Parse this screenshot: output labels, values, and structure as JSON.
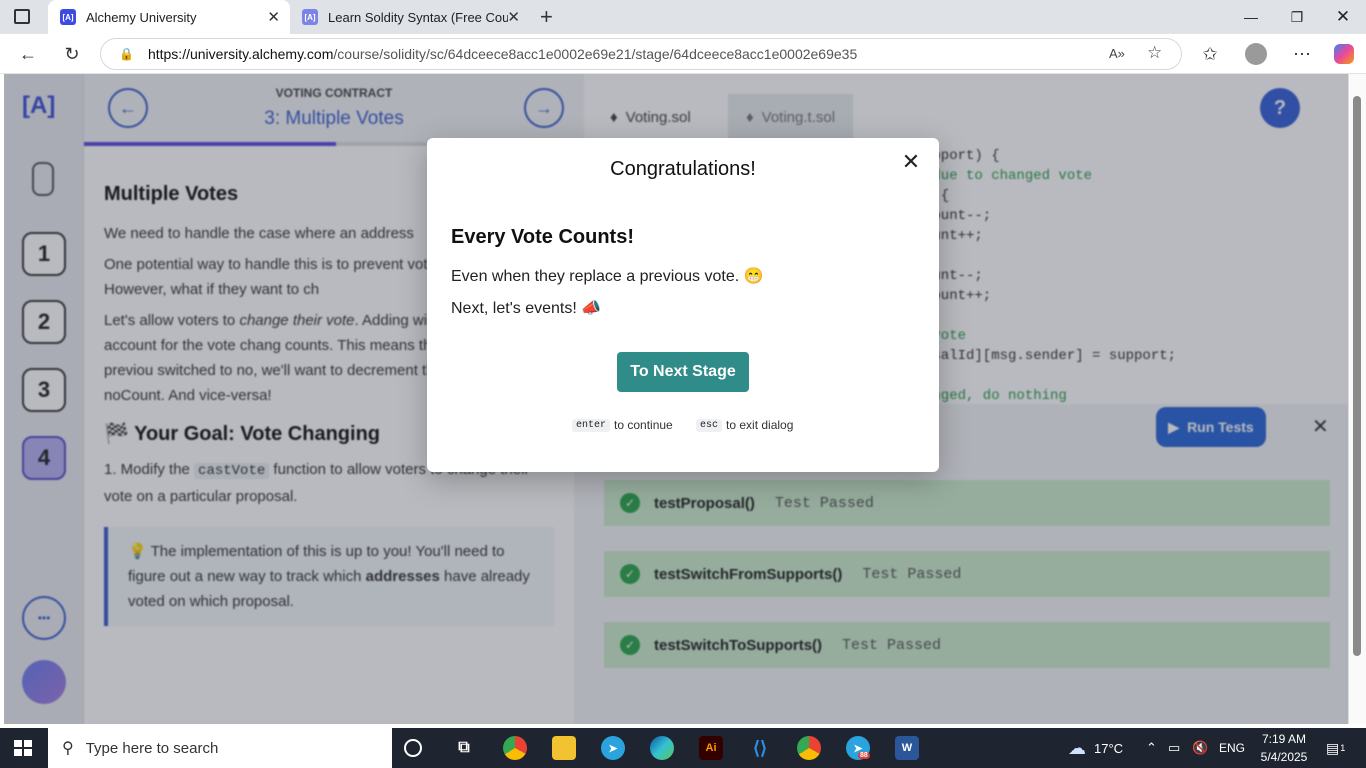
{
  "browser": {
    "tabs": [
      {
        "title": "Alchemy University",
        "favicon": "[A]"
      },
      {
        "title": "Learn Soldity Syntax (Free Course)",
        "favicon": "[A]"
      }
    ],
    "url_host": "https://university.alchemy.com",
    "url_path": "/course/solidity/sc/64dceece8acc1e0002e69e21/stage/64dceece8acc1e0002e69e35"
  },
  "sidebar": {
    "logo": "[A]",
    "stages": [
      "1",
      "2",
      "3",
      "4"
    ],
    "more": "•••"
  },
  "lesson": {
    "section": "VOTING CONTRACT",
    "title": "3: Multiple Votes",
    "heading": "Multiple Votes",
    "p1": "We need to handle the case where an address",
    "p2": "One potential way to handle this is to prevent voting twice. However, what if they want to ch",
    "p3_start": "Let's allow voters to ",
    "p3_em": "change their vote",
    "p3_end": ". Adding will require that we account for the vote chang counts. This means that if the address previou switched to no, we'll want to decrement the y increment the noCount. And vice-versa!",
    "goal": "🏁 Your Goal: Vote Changing",
    "goal_item_start": "1. Modify the ",
    "goal_item_code": "castVote",
    "goal_item_end": " function to allow voters to change their vote on a particular proposal.",
    "hint_start": "💡 The implementation of this is up to you! You'll need to figure out a new way to track which ",
    "hint_bold": "addresses",
    "hint_end": " have already voted on which proposal."
  },
  "editor": {
    "tabs": [
      "Voting.sol",
      "Voting.t.sol"
    ],
    "code_lines": [
      {
        "text": "upport) {",
        "comment": false
      },
      {
        "text": " due to changed vote",
        "comment": true
      },
      {
        "text": ") {",
        "comment": false
      },
      {
        "text": "Count--;",
        "comment": false
      },
      {
        "text": "ount++;",
        "comment": false
      },
      {
        "text": "",
        "comment": false
      },
      {
        "text": "ount--;",
        "comment": false
      },
      {
        "text": "Count++;",
        "comment": false
      },
      {
        "text": "",
        "comment": false
      },
      {
        "text": " vote",
        "comment": true
      },
      {
        "text": "osalId][msg.sender] = support;",
        "comment": false
      },
      {
        "text": "",
        "comment": false
      },
      {
        "text": "anged, do nothing",
        "comment": true
      }
    ]
  },
  "tests": {
    "run_label": "Run Tests",
    "results": [
      {
        "name": "testProposal()",
        "status": "Test Passed"
      },
      {
        "name": "testSwitchFromSupports()",
        "status": "Test Passed"
      },
      {
        "name": "testSwitchToSupports()",
        "status": "Test Passed"
      }
    ]
  },
  "modal": {
    "title": "Congratulations!",
    "heading": "Every Vote Counts!",
    "line1": "Even when they replace a previous vote. 😁",
    "line2": "Next, let's events! 📣",
    "button": "To Next Stage",
    "enter_key": "enter",
    "enter_text": "to continue",
    "esc_key": "esc",
    "esc_text": "to exit dialog"
  },
  "taskbar": {
    "search_placeholder": "Type here to search",
    "weather": "17°C",
    "language": "ENG",
    "time": "7:19 AM",
    "date": "5/4/2025",
    "telegram_badge": "88",
    "notifications": "1"
  },
  "colors": {
    "accent": "#5b4de0",
    "teal_button": "#2f8c88",
    "run_button": "#2a66d8",
    "test_pass_bg": "#cdeccd"
  }
}
